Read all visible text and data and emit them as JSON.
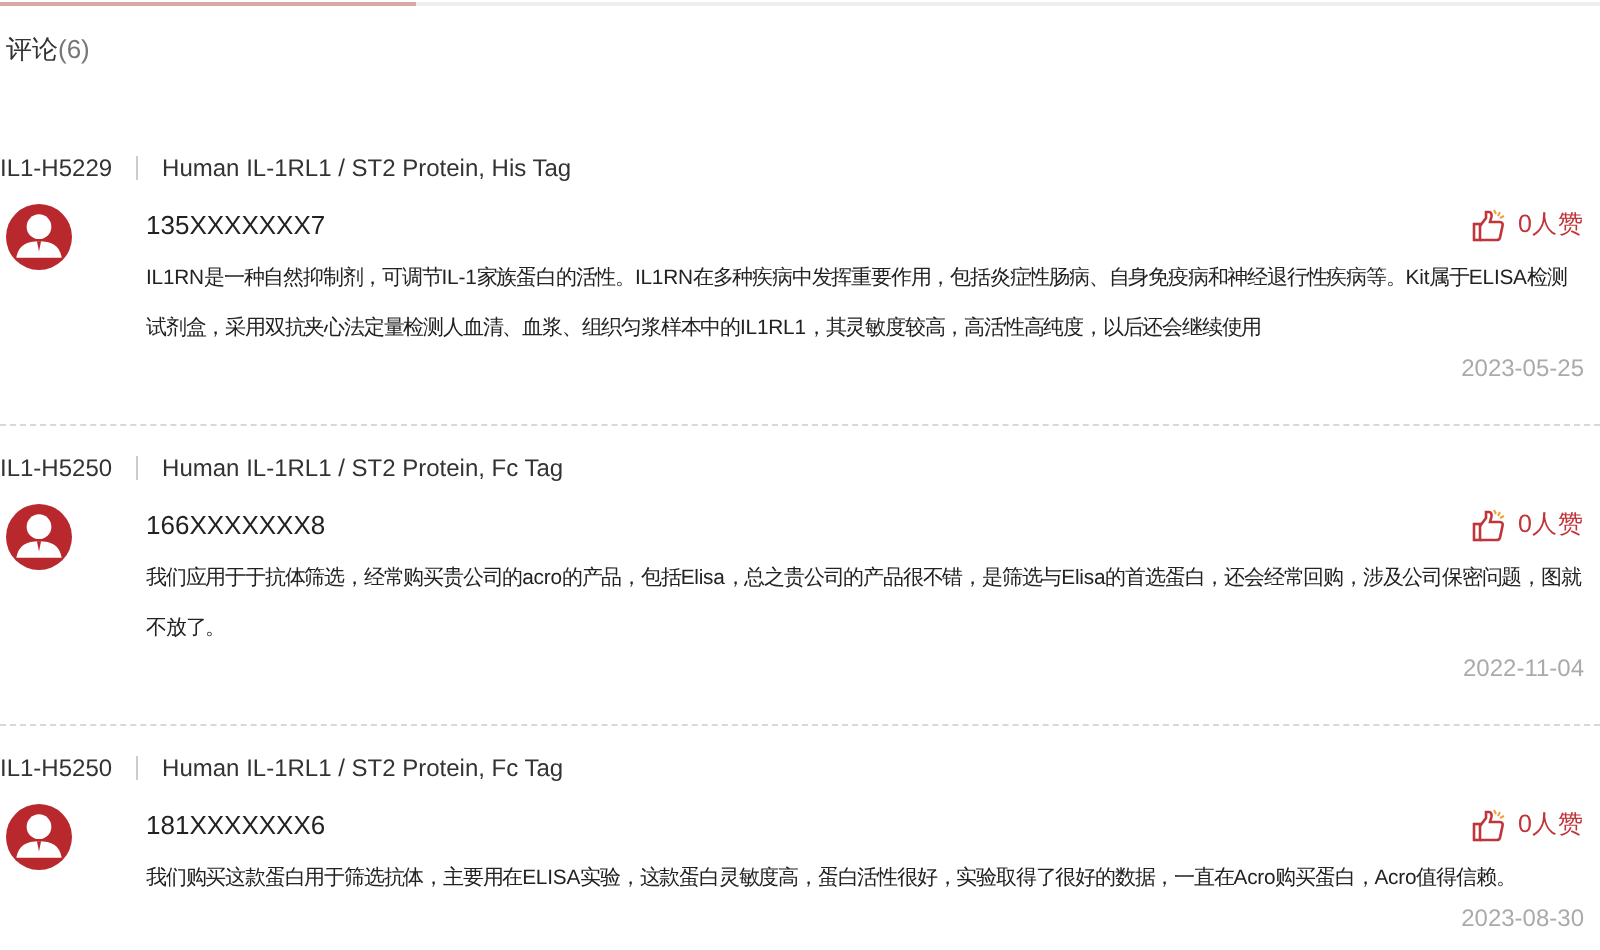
{
  "section": {
    "title": "评论",
    "count": "(6)"
  },
  "comments": [
    {
      "catalog": "IL1-H5229",
      "product": "Human IL-1RL1 / ST2 Protein, His Tag",
      "user": "135XXXXXXX7",
      "likes": "0人赞",
      "text": "IL1RN是一种自然抑制剂，可调节IL-1家族蛋白的活性。IL1RN在多种疾病中发挥重要作用，包括炎症性肠病、自身免疫病和神经退行性疾病等。Kit属于ELISA检测试剂盒，采用双抗夹心法定量检测人血清、血浆、组织匀浆样本中的IL1RL1，其灵敏度较高，高活性高纯度，以后还会继续使用",
      "date": "2023-05-25"
    },
    {
      "catalog": "IL1-H5250",
      "product": "Human IL-1RL1 / ST2 Protein, Fc Tag",
      "user": "166XXXXXXX8",
      "likes": "0人赞",
      "text": "我们应用于于抗体筛选，经常购买贵公司的acro的产品，包括Elisa，总之贵公司的产品很不错，是筛选与Elisa的首选蛋白，还会经常回购，涉及公司保密问题，图就不放了。",
      "date": "2022-11-04"
    },
    {
      "catalog": "IL1-H5250",
      "product": "Human IL-1RL1 / ST2 Protein, Fc Tag",
      "user": "181XXXXXXX6",
      "likes": "0人赞",
      "text": "我们购买这款蛋白用于筛选抗体，主要用在ELISA实验，这款蛋白灵敏度高，蛋白活性很好，实验取得了很好的数据，一直在Acro购买蛋白，Acro值得信赖。",
      "date": "2023-08-30"
    }
  ]
}
